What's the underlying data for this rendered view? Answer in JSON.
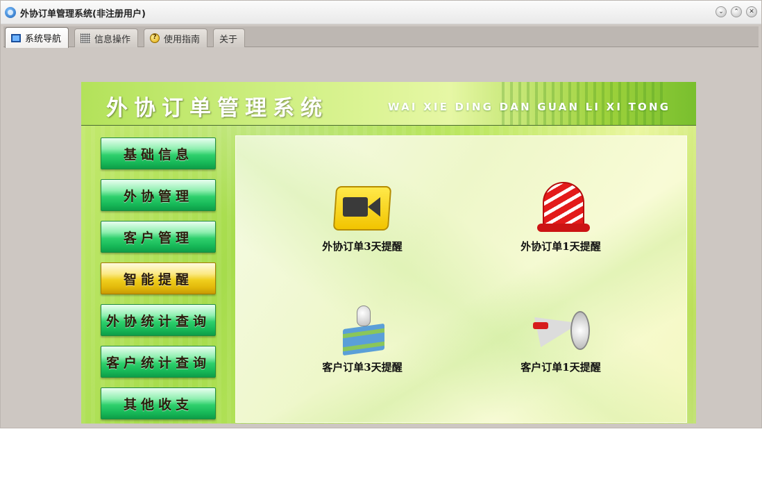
{
  "window": {
    "title": "外协订单管理系统(非注册用户)",
    "controls": [
      "⌄",
      "⌃",
      "✕"
    ]
  },
  "tabs": [
    {
      "label": "系统导航",
      "icon": "nav-screen-icon",
      "active": true
    },
    {
      "label": "信息操作",
      "icon": "grid-icon",
      "active": false
    },
    {
      "label": "使用指南",
      "icon": "help-icon",
      "active": false
    },
    {
      "label": "关于",
      "icon": "",
      "active": false
    }
  ],
  "banner": {
    "title": "外协订单管理系统",
    "subtitle": "WAI XIE DING DAN GUAN LI XI TONG"
  },
  "menu": [
    {
      "label": "基础信息",
      "active": false
    },
    {
      "label": "外协管理",
      "active": false
    },
    {
      "label": "客户管理",
      "active": false
    },
    {
      "label": "智能提醒",
      "active": true
    },
    {
      "label": "外协统计查询",
      "active": false
    },
    {
      "label": "客户统计查询",
      "active": false
    },
    {
      "label": "其他收支",
      "active": false
    }
  ],
  "reminders": [
    {
      "label": "外协订单3天提醒",
      "icon": "video-camera-icon"
    },
    {
      "label": "外协订单1天提醒",
      "icon": "alarm-bell-icon"
    },
    {
      "label": "客户订单3天提醒",
      "icon": "books-bulb-icon"
    },
    {
      "label": "客户订单1天提醒",
      "icon": "megaphone-icon"
    }
  ],
  "colors": {
    "menu_green": "#17b958",
    "menu_active_yellow": "#f0cf1e",
    "banner_green": "#a6dc4c"
  }
}
